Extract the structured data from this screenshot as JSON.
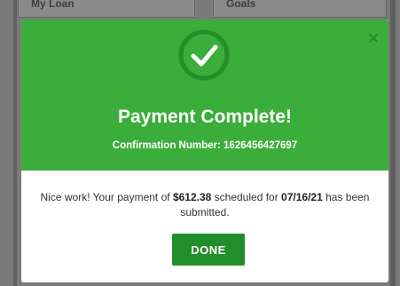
{
  "background": {
    "card_left_title": "My Loan",
    "card_right_title": "Goals"
  },
  "modal": {
    "title": "Payment Complete!",
    "confirmation_label": "Confirmation Number:",
    "confirmation_number": "1626456427697",
    "message_prefix": "Nice work! Your payment of ",
    "amount": "$612.38",
    "message_middle": " scheduled for ",
    "date": "07/16/21",
    "message_suffix": " has been submitted.",
    "done_label": "DONE",
    "icons": {
      "success": "check-circle-icon",
      "close": "close-icon"
    }
  },
  "colors": {
    "header_green": "#3aad3a",
    "button_green": "#218e2b",
    "overlay_gray": "#7a7a7a"
  }
}
